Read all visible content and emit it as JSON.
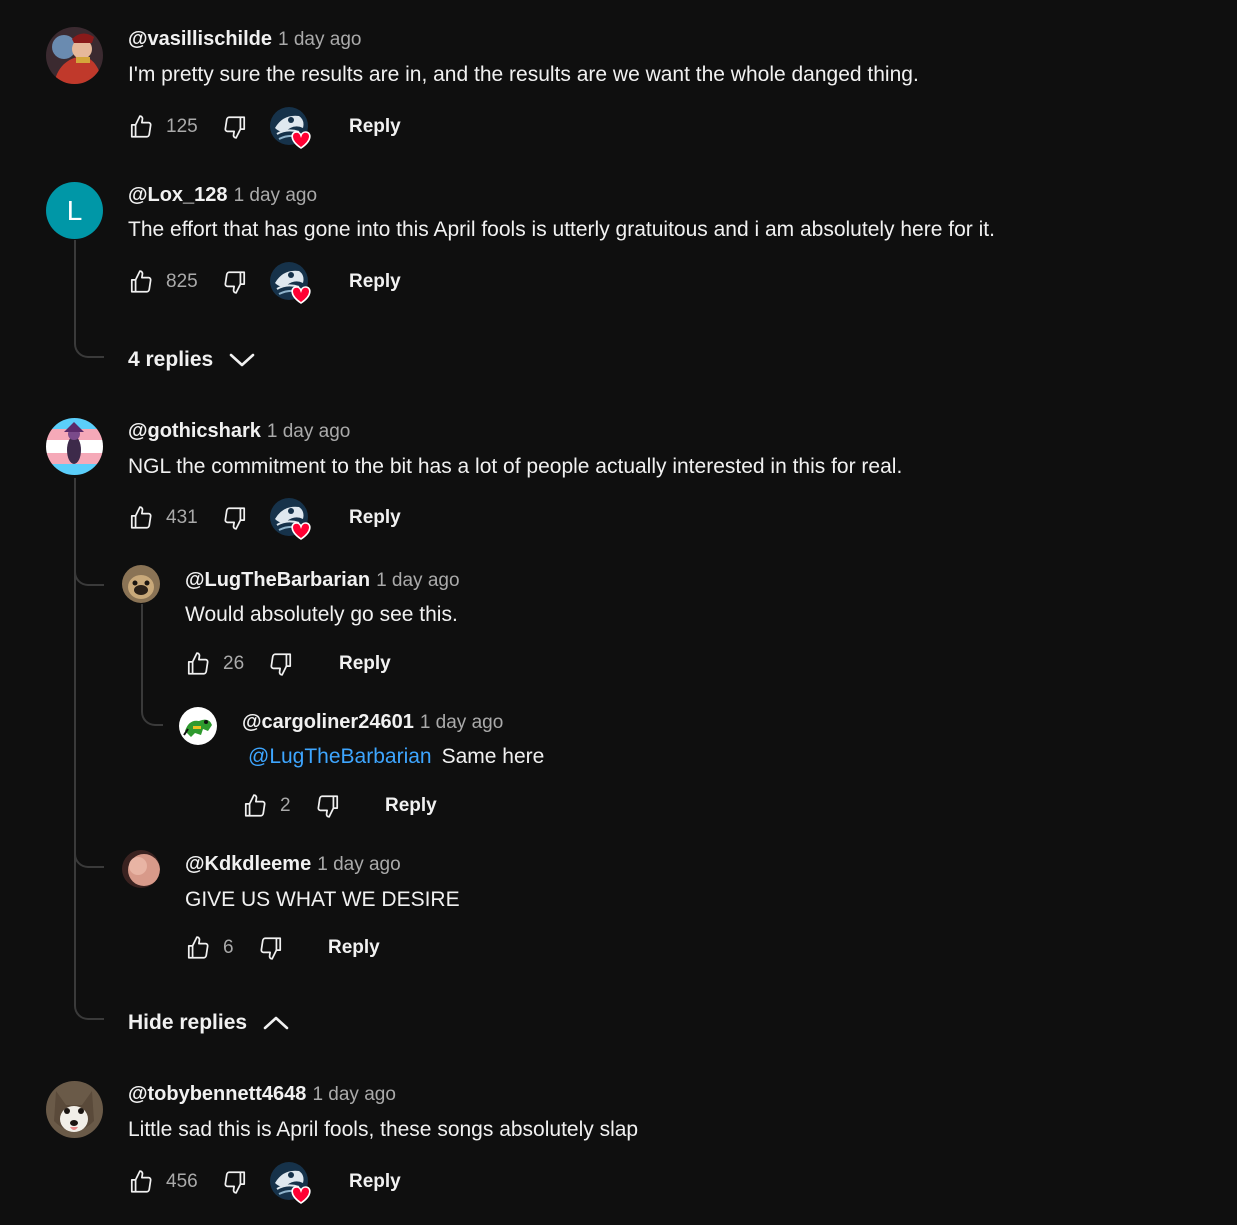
{
  "comments": [
    {
      "handle": "@vasillischilde",
      "time": "1 day ago",
      "text": "I'm pretty sure the results are in, and the results are we want the whole danged thing.",
      "likes": "125",
      "reply_label": "Reply"
    },
    {
      "handle": "@Lox_128",
      "time": "1 day ago",
      "avatar_letter": "L",
      "text": "The effort that has gone into this April fools is utterly gratuitous and i am absolutely here for it.",
      "likes": "825",
      "reply_label": "Reply",
      "replies_toggle": "4 replies"
    },
    {
      "handle": "@gothicshark",
      "time": "1 day ago",
      "text": "NGL the commitment to the bit has a lot of people actually interested in this for real.",
      "likes": "431",
      "reply_label": "Reply",
      "replies_toggle": "Hide replies",
      "replies": [
        {
          "handle": "@LugTheBarbarian",
          "time": "1 day ago",
          "text": "Would absolutely go see this.",
          "likes": "26",
          "reply_label": "Reply"
        },
        {
          "handle": "@cargoliner24601",
          "time": "1 day ago",
          "mention": "@LugTheBarbarian",
          "text": "Same here",
          "likes": "2",
          "reply_label": "Reply"
        },
        {
          "handle": "@Kdkdleeme",
          "time": "1 day ago",
          "text": "GIVE US WHAT WE DESIRE",
          "likes": "6",
          "reply_label": "Reply"
        }
      ]
    },
    {
      "handle": "@tobybennett4648",
      "time": "1 day ago",
      "text": "Little sad this is April fools, these songs absolutely slap",
      "likes": "456",
      "reply_label": "Reply"
    }
  ],
  "icons": {
    "like": "thumbs-up-icon",
    "dislike": "thumbs-down-icon",
    "creator_heart": "creator-heart-icon",
    "expand": "chevron-down-icon",
    "collapse": "chevron-up-icon"
  },
  "colors": {
    "background": "#0f0f0f",
    "text": "#f1f1f1",
    "secondary": "#aaaaaa",
    "mention": "#3ea6ff",
    "heart": "#ff0033",
    "letter_avatar": "#0097a7"
  }
}
